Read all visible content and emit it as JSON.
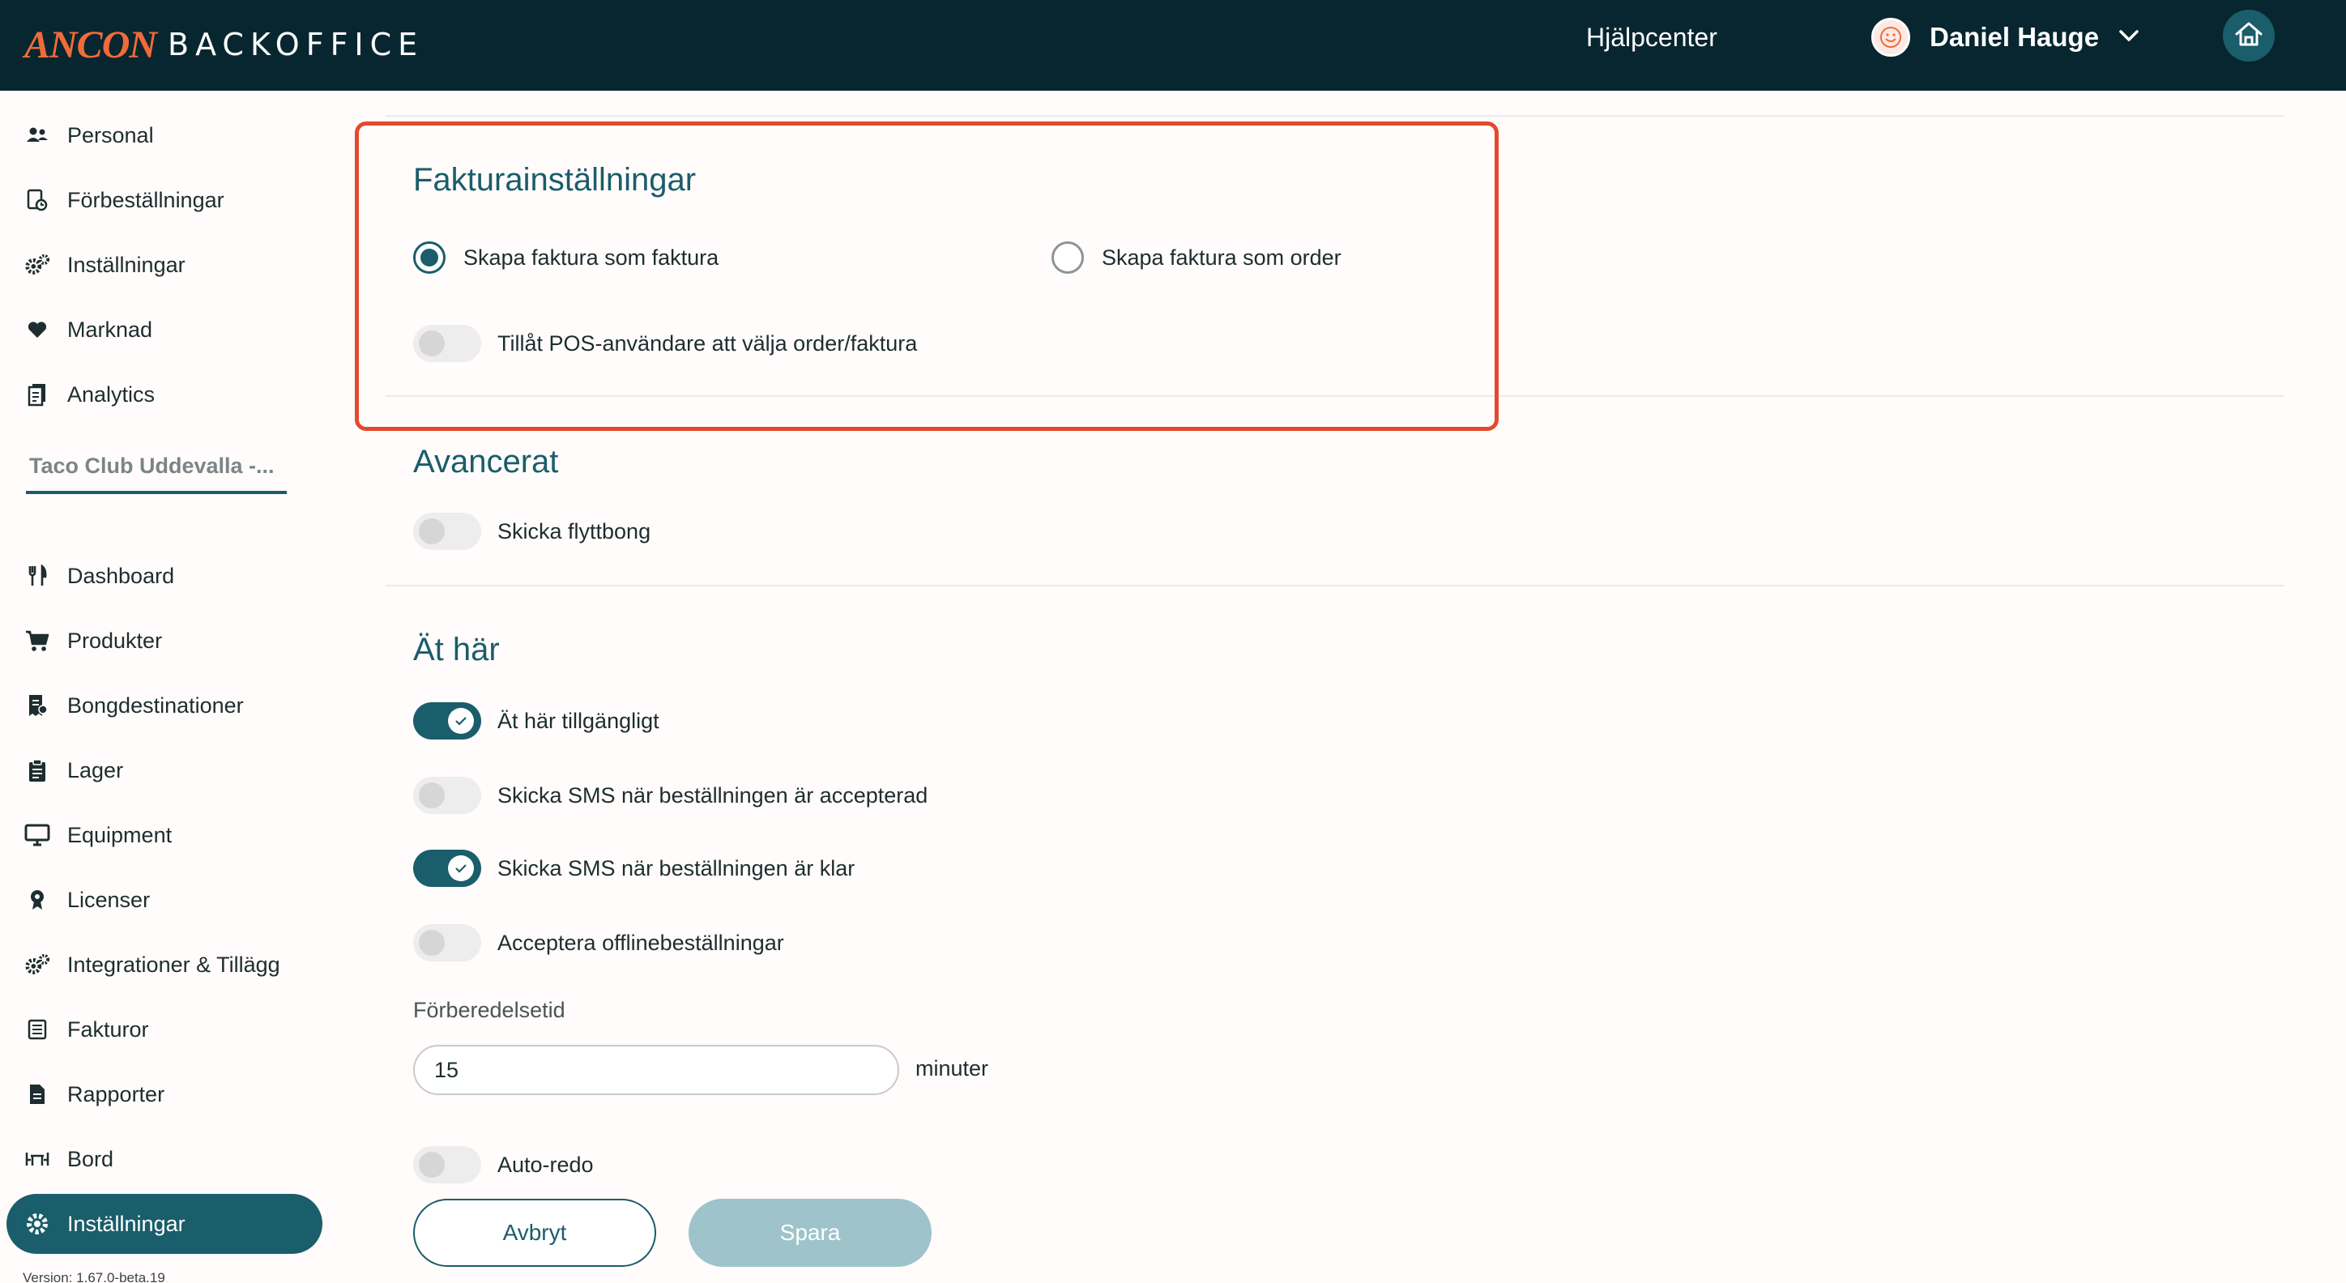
{
  "header": {
    "logo_brand": "ANCON",
    "logo_product": "BACKOFFICE",
    "help_link": "Hjälpcenter",
    "user_name": "Daniel Hauge",
    "icons": [
      "avatar-smiley-icon",
      "chevron-down-icon",
      "home-icon"
    ]
  },
  "sidebar": {
    "top_items": [
      {
        "label": "Personal",
        "icon": "people-icon"
      },
      {
        "label": "Förbeställningar",
        "icon": "preorder-icon"
      },
      {
        "label": "Inställningar",
        "icon": "gears-icon"
      },
      {
        "label": "Marknad",
        "icon": "heart-icon"
      },
      {
        "label": "Analytics",
        "icon": "documents-icon"
      }
    ],
    "store_selector": "Taco Club Uddevalla -...",
    "store_items": [
      {
        "label": "Dashboard",
        "icon": "cutlery-icon"
      },
      {
        "label": "Produkter",
        "icon": "cart-icon"
      },
      {
        "label": "Bongdestinationer",
        "icon": "receipt-icon"
      },
      {
        "label": "Lager",
        "icon": "clipboard-icon"
      },
      {
        "label": "Equipment",
        "icon": "monitor-icon"
      },
      {
        "label": "Licenser",
        "icon": "license-icon"
      },
      {
        "label": "Integrationer & Tillägg",
        "icon": "gears-icon"
      },
      {
        "label": "Fakturor",
        "icon": "invoice-icon"
      },
      {
        "label": "Rapporter",
        "icon": "report-icon"
      },
      {
        "label": "Bord",
        "icon": "table-icon"
      },
      {
        "label": "Inställningar",
        "icon": "gear-icon",
        "active": true
      }
    ],
    "version": "Version: 1.67.0-beta.19"
  },
  "invoice_settings": {
    "title": "Fakturainställningar",
    "option_invoice": "Skapa faktura som faktura",
    "option_order": "Skapa faktura som order",
    "selected": "invoice",
    "pos_toggle_label": "Tillåt POS-användare att välja order/faktura",
    "pos_toggle_on": false
  },
  "advanced": {
    "title": "Avancerat",
    "send_move_ticket_label": "Skicka flyttbong",
    "send_move_ticket_on": false
  },
  "eat_here": {
    "title": "Ät här",
    "available_label": "Ät här tillgängligt",
    "available_on": true,
    "sms_accepted_label": "Skicka SMS när beställningen är accepterad",
    "sms_accepted_on": false,
    "sms_ready_label": "Skicka SMS när beställningen är klar",
    "sms_ready_on": true,
    "offline_orders_label": "Acceptera offlinebeställningar",
    "offline_orders_on": false,
    "prep_time_label": "Förberedelsetid",
    "prep_time_value": "15",
    "prep_time_unit": "minuter",
    "auto_ready_label": "Auto-redo",
    "auto_ready_on": false
  },
  "actions": {
    "cancel_label": "Avbryt",
    "save_label": "Spara"
  },
  "colors": {
    "topbar": "#08262f",
    "accent": "#1a5d6b",
    "brand_orange": "#f06b3a",
    "highlight_red": "#e4492e",
    "save_disabled": "#9ec3cb"
  }
}
